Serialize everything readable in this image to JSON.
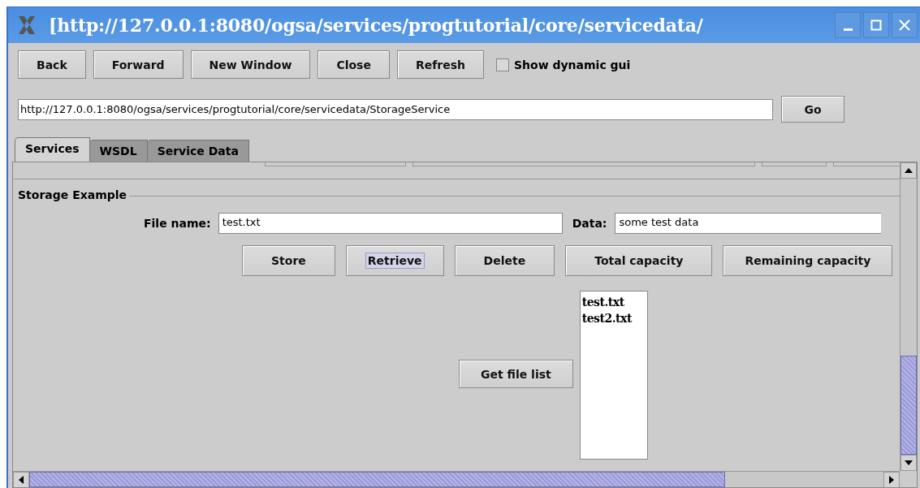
{
  "window": {
    "title": "[http://127.0.0.1:8080/ogsa/services/progtutorial/core/servicedata/"
  },
  "toolbar": {
    "buttons": [
      {
        "label": "Back"
      },
      {
        "label": "Forward"
      },
      {
        "label": "New Window"
      },
      {
        "label": "Close"
      },
      {
        "label": "Refresh"
      }
    ],
    "dynamic_gui": {
      "label": "Show dynamic gui",
      "checked": false
    }
  },
  "address": {
    "value": "http://127.0.0.1:8080/ogsa/services/progtutorial/core/servicedata/StorageService",
    "button": "Go"
  },
  "tabs": [
    {
      "label": "Services",
      "selected": true
    },
    {
      "label": "WSDL",
      "selected": false
    },
    {
      "label": "Service Data",
      "selected": false
    }
  ],
  "storage": {
    "title": "Storage Example",
    "file_name": {
      "label": "File name:",
      "value": "test.txt"
    },
    "data": {
      "label": "Data:",
      "value": "some test data"
    },
    "buttons": [
      {
        "label": "Store",
        "focused": false
      },
      {
        "label": "Retrieve",
        "focused": true
      },
      {
        "label": "Delete",
        "focused": false
      },
      {
        "label": "Total capacity",
        "focused": false
      },
      {
        "label": "Remaining capacity",
        "focused": false
      }
    ],
    "list_button": "Get file list",
    "files": [
      "test.txt",
      "test2.txt"
    ]
  }
}
